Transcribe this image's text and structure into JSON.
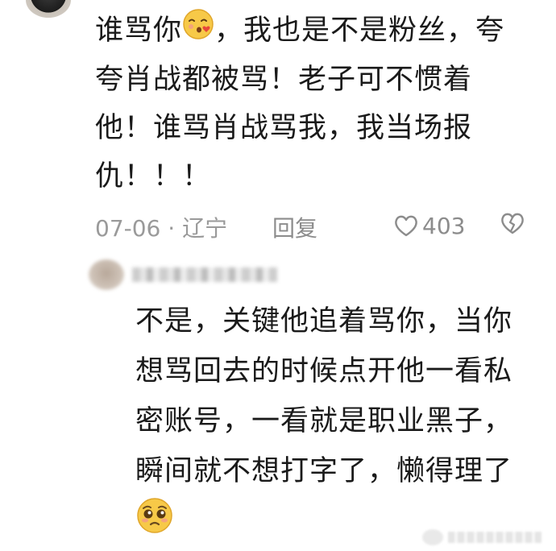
{
  "comment": {
    "lines": [
      "谁骂你",
      "，我也是不是粉丝，夸",
      "夸肖战都被骂！老子可不惯着",
      "他！谁骂肖战骂我，我当场报",
      "仇！！！"
    ],
    "emoji": "blowing-kiss-emoji",
    "date": "07-06 · 辽宁",
    "reply_label": "回复",
    "like_count": "403"
  },
  "reply": {
    "lines": [
      "不是，关键他追着骂你，当你",
      "想骂回去的时候点开他一看私",
      "密账号，一看就是职业黑子，",
      "瞬间就不想打字了，懒得理了"
    ],
    "emoji": "pleading-face-emoji"
  }
}
